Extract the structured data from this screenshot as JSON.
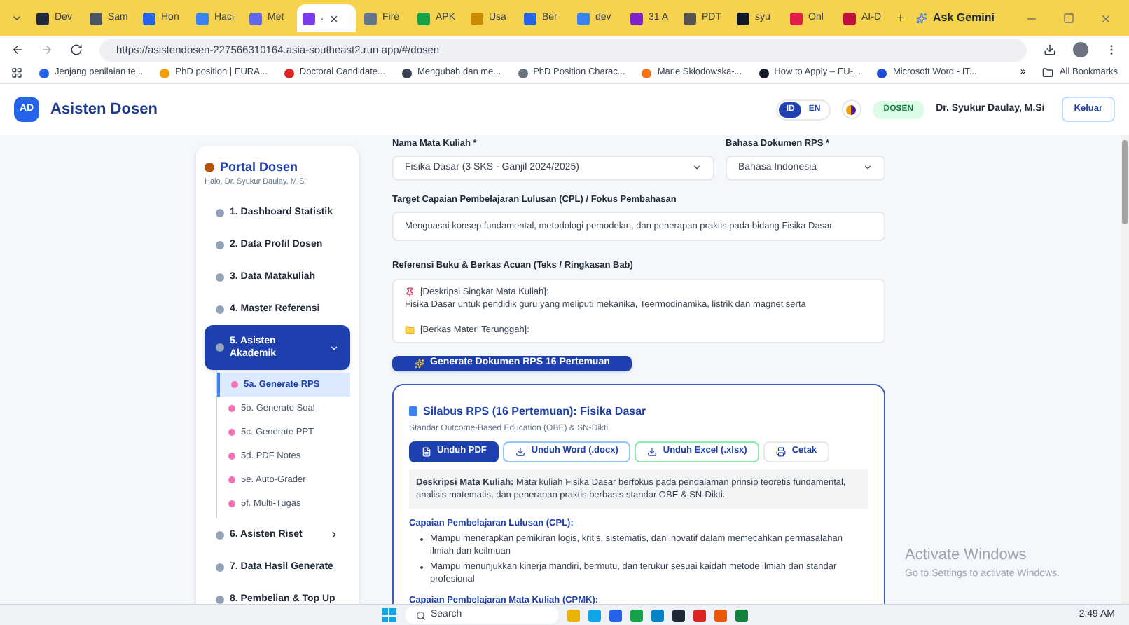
{
  "browser": {
    "tabs": [
      {
        "label": "Dev",
        "color": "#1f2937",
        "selected": false
      },
      {
        "label": "Sam",
        "color": "#4b5563",
        "selected": false
      },
      {
        "label": "Hon",
        "color": "#2563eb",
        "selected": false
      },
      {
        "label": "Haci",
        "color": "#3b82f6",
        "selected": false
      },
      {
        "label": "Met",
        "color": "#6366f1",
        "selected": false
      },
      {
        "label": ".",
        "color": "#7c3aed",
        "selected": true
      },
      {
        "label": "Fire",
        "color": "#64748b",
        "selected": false
      },
      {
        "label": "APK",
        "color": "#16a34a",
        "selected": false
      },
      {
        "label": "Usa",
        "color": "#ca8a04",
        "selected": false
      },
      {
        "label": "Ber",
        "color": "#2563eb",
        "selected": false
      },
      {
        "label": "dev",
        "color": "#3b82f6",
        "selected": false
      },
      {
        "label": "31 A",
        "color": "#7e22ce",
        "selected": false
      },
      {
        "label": "PDT",
        "color": "#57534e",
        "selected": false
      },
      {
        "label": "syu",
        "color": "#111827",
        "selected": false
      },
      {
        "label": "Onl",
        "color": "#e11d48",
        "selected": false
      },
      {
        "label": "AI-D",
        "color": "#be123c",
        "selected": false
      }
    ],
    "new_tab": "+",
    "ask_gemini": "Ask Gemini",
    "url": "https://asistendosen-227566310164.asia-southeast2.run.app/#/dosen",
    "bookmarks": [
      {
        "label": "Jenjang penilaian te...",
        "color": "#2563eb"
      },
      {
        "label": "PhD position | EURA...",
        "color": "#f59e0b"
      },
      {
        "label": "Doctoral Candidate...",
        "color": "#dc2626"
      },
      {
        "label": "Mengubah dan me...",
        "color": "#374151"
      },
      {
        "label": "PhD Position Charac...",
        "color": "#6b7280"
      },
      {
        "label": "Marie Skłodowska-...",
        "color": "#f97316"
      },
      {
        "label": "How to Apply – EU-...",
        "color": "#111827"
      },
      {
        "label": "Microsoft Word - IT...",
        "color": "#1d4ed8"
      }
    ],
    "more": "»",
    "all_bookmarks": "All Bookmarks"
  },
  "app_header": {
    "logo": "AD",
    "title": "Asisten Dosen",
    "languages": [
      {
        "label": "ID",
        "selected": true
      },
      {
        "label": "EN",
        "selected": false
      }
    ],
    "role": "DOSEN",
    "user": "Dr. Syukur Daulay, M.Si",
    "logout": "Keluar"
  },
  "sidebar": {
    "title": "Portal Dosen",
    "greeting": "Halo, Dr. Syukur Daulay, M.Si",
    "items": [
      {
        "label": "1. Dashboard Statistik",
        "selected": false
      },
      {
        "label": "2. Data Profil Dosen",
        "selected": false
      },
      {
        "label": "3. Data Matakuliah",
        "selected": false
      },
      {
        "label": "4. Master Referensi",
        "selected": false
      },
      {
        "label": "5. Asisten Akademik",
        "selected": true,
        "expanded": true,
        "children": [
          {
            "label": "5a. Generate RPS",
            "selected": true
          },
          {
            "label": "5b. Generate Soal",
            "selected": false
          },
          {
            "label": "5c. Generate PPT",
            "selected": false
          },
          {
            "label": "5d. PDF Notes",
            "selected": false
          },
          {
            "label": "5e. Auto-Grader",
            "selected": false
          },
          {
            "label": "5f. Multi-Tugas",
            "selected": false
          }
        ]
      },
      {
        "label": "6. Asisten Riset",
        "selected": false,
        "expanded": false
      },
      {
        "label": "7. Data Hasil Generate",
        "selected": false
      },
      {
        "label": "8. Pembelian & Top Up",
        "selected": false
      }
    ]
  },
  "form": {
    "course_label": "Nama Mata Kuliah *",
    "course_value": "Fisika Dasar (3 SKS - Ganjil 2024/2025)",
    "language_label": "Bahasa Dokumen RPS *",
    "language_value": "Bahasa Indonesia",
    "cpl_label": "Target Capaian Pembelajaran Lulusan (CPL) / Fokus Pembahasan",
    "cpl_value": "Menguasai konsep fundamental, metodologi pemodelan, dan penerapan praktis pada bidang Fisika Dasar",
    "ref_label": "Referensi Buku & Berkas Acuan (Teks / Ringkasan Bab)",
    "ref_blocks": [
      {
        "kind": "pin",
        "lines": [
          "[Deskripsi Singkat Mata Kuliah]:",
          "Fisika Dasar untuk pendidik guru yang meliputi mekanika, Teermodinamika, listrik dan magnet serta"
        ]
      },
      {
        "kind": "folder",
        "lines": [
          "[Berkas Materi Terunggah]:"
        ]
      }
    ],
    "generate_button": "Generate Dokumen RPS 16 Pertemuan"
  },
  "result": {
    "title": "Silabus RPS (16 Pertemuan): Fisika Dasar",
    "subtitle": "Standar Outcome-Based Education (OBE) & SN-Dikti",
    "actions": [
      {
        "label": "Unduh PDF",
        "kind": "primary"
      },
      {
        "label": "Unduh Word (.docx)",
        "kind": "blue"
      },
      {
        "label": "Unduh Excel (.xlsx)",
        "kind": "green"
      },
      {
        "label": "Cetak",
        "kind": "plain"
      }
    ],
    "description": "**Deskripsi Mata Kuliah:** Mata kuliah Fisika Dasar berfokus pada pendalaman prinsip teoretis fundamental, analisis matematis, dan penerapan praktis berbasis standar OBE & SN-Dikti.",
    "cpl_heading": "Capaian Pembelajaran Lulusan (CPL):",
    "cpl_items": [
      "Mampu menerapkan pemikiran logis, kritis, sistematis, dan inovatif dalam memecahkan permasalahan ilmiah dan keilmuan",
      "Mampu menunjukkan kinerja mandiri, bermutu, dan terukur sesuai kaidah metode ilmiah dan standar profesional"
    ],
    "cpmk_heading": "Capaian Pembelajaran Mata Kuliah (CPMK):"
  },
  "activation": {
    "title": "Activate Windows",
    "hint": "Go to Settings to activate Windows."
  },
  "taskbar": {
    "search": "Search",
    "apps": [
      {
        "color": "#eab308"
      },
      {
        "color": "#0ea5e9"
      },
      {
        "color": "#2563eb"
      },
      {
        "color": "#16a34a"
      },
      {
        "color": "#0284c7"
      },
      {
        "color": "#1f2937"
      },
      {
        "color": "#dc2626"
      },
      {
        "color": "#ea580c"
      },
      {
        "color": "#15803d"
      }
    ],
    "time": "2:49 AM"
  }
}
